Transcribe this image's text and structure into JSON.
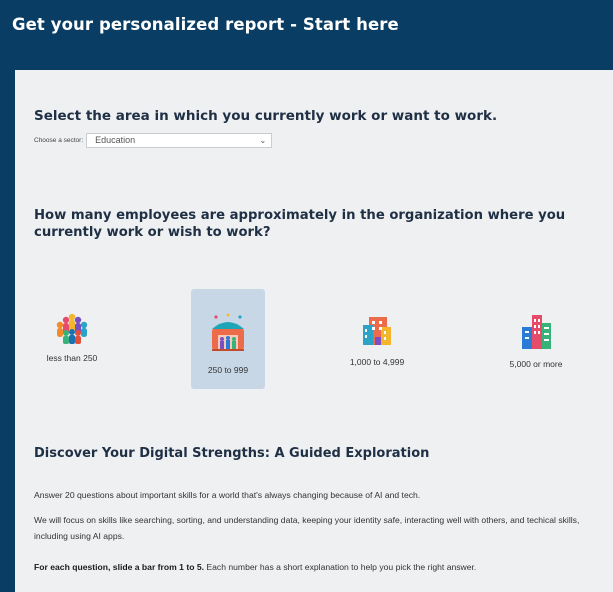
{
  "header": {
    "title": "Get your personalized report - Start here"
  },
  "sector": {
    "heading": "Select the area in which you currently work or want to work.",
    "label": "Choose a sector:",
    "selected": "Education"
  },
  "size": {
    "heading": "How many employees are approximately in the organization where you currently work or wish to work?",
    "options": [
      {
        "label": "less than 250",
        "icon": "small-team-icon",
        "selected": false
      },
      {
        "label": "250 to 999",
        "icon": "medium-team-icon",
        "selected": true
      },
      {
        "label": "1,000 to 4,999",
        "icon": "office-building-icon",
        "selected": false
      },
      {
        "label": "5,000 or more",
        "icon": "skyscraper-icon",
        "selected": false
      }
    ]
  },
  "discover": {
    "heading": "Discover Your Digital Strengths: A Guided Exploration",
    "p1": "Answer 20 questions about important skills for a world that's always changing because of AI and tech.",
    "p2": "We will focus on skills like searching, sorting, and understanding data, keeping your identity safe, interacting well with others, and techical skills, including using AI apps.",
    "p3_bold": "For each question, slide a bar from 1 to 5.",
    "p3_rest": " Each number has a short explanation to help you pick the right answer."
  },
  "colors": {
    "header_bg": "#0a3d64",
    "panel_bg": "#eef0f2",
    "selected_bg": "#c8d7e6"
  }
}
